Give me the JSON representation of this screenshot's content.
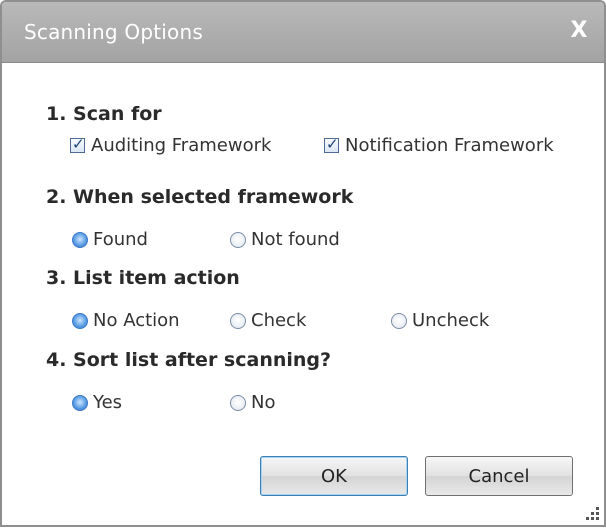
{
  "dialog": {
    "title": "Scanning Options",
    "close_label": "X"
  },
  "sections": {
    "scan_for": {
      "title": "1. Scan for",
      "options": [
        {
          "label": "Auditing Framework",
          "checked": true
        },
        {
          "label": "Notification Framework",
          "checked": true
        }
      ]
    },
    "when_selected": {
      "title": "2. When selected framework",
      "options": [
        {
          "label": "Found",
          "selected": true
        },
        {
          "label": "Not found",
          "selected": false
        }
      ]
    },
    "list_action": {
      "title": "3. List item action",
      "options": [
        {
          "label": "No Action",
          "selected": true
        },
        {
          "label": "Check",
          "selected": false
        },
        {
          "label": "Uncheck",
          "selected": false
        }
      ]
    },
    "sort_after": {
      "title": "4. Sort list after scanning?",
      "options": [
        {
          "label": "Yes",
          "selected": true
        },
        {
          "label": "No",
          "selected": false
        }
      ]
    }
  },
  "buttons": {
    "ok_label": "OK",
    "cancel_label": "Cancel"
  },
  "icons": {
    "check_glyph": "✓"
  },
  "colors": {
    "titlebar": "#a8a8a8",
    "radio_selected": "#3b78c4"
  }
}
